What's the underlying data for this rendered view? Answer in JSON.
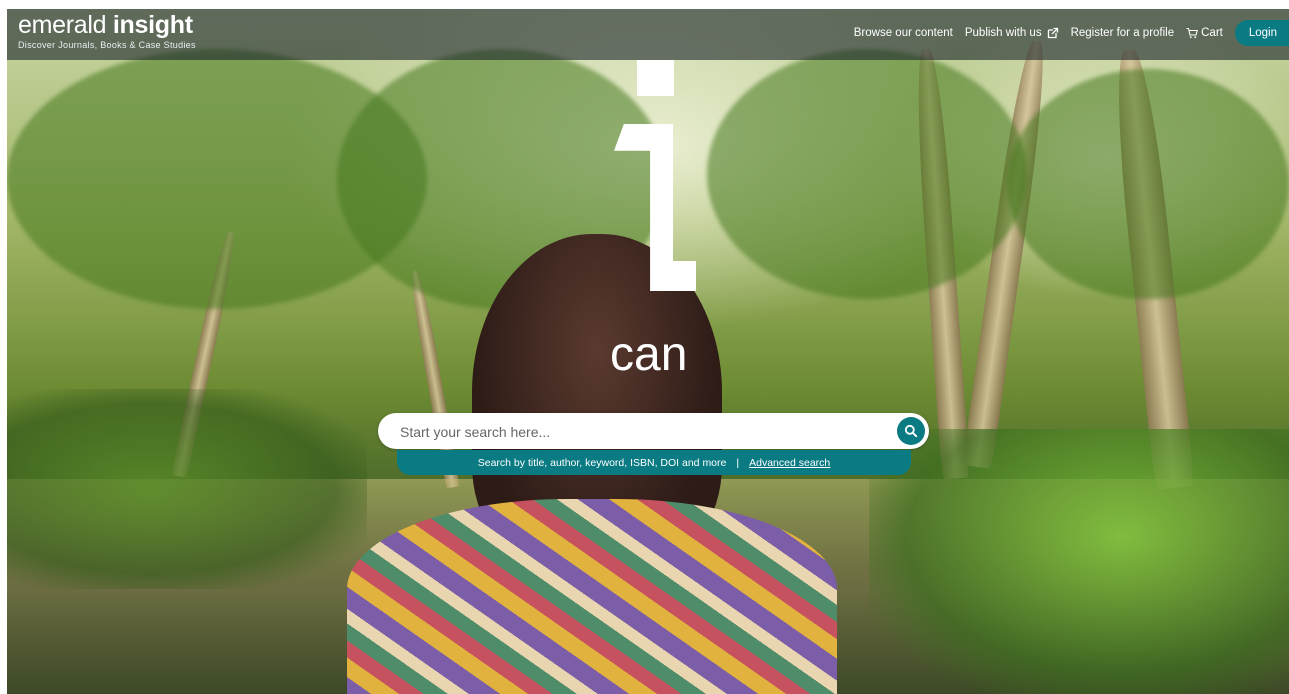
{
  "header": {
    "brand_name_light": "emerald",
    "brand_name_bold": "insight",
    "tagline": "Discover Journals, Books & Case Studies",
    "nav": {
      "browse": "Browse our content",
      "publish": "Publish with us",
      "register": "Register for a profile",
      "cart": "Cart",
      "login": "Login"
    }
  },
  "hero": {
    "mark_letter": "i",
    "headline": "can"
  },
  "search": {
    "placeholder": "Start your search here...",
    "hint": "Search by title, author, keyword, ISBN, DOI and more",
    "separator": "|",
    "advanced_label": "Advanced search"
  },
  "icons": {
    "external": "external-link-icon",
    "cart": "cart-icon",
    "search": "search-icon"
  },
  "colors": {
    "accent": "#0a7a83",
    "header_overlay": "rgba(30,40,45,0.62)",
    "text": "#ffffff"
  }
}
